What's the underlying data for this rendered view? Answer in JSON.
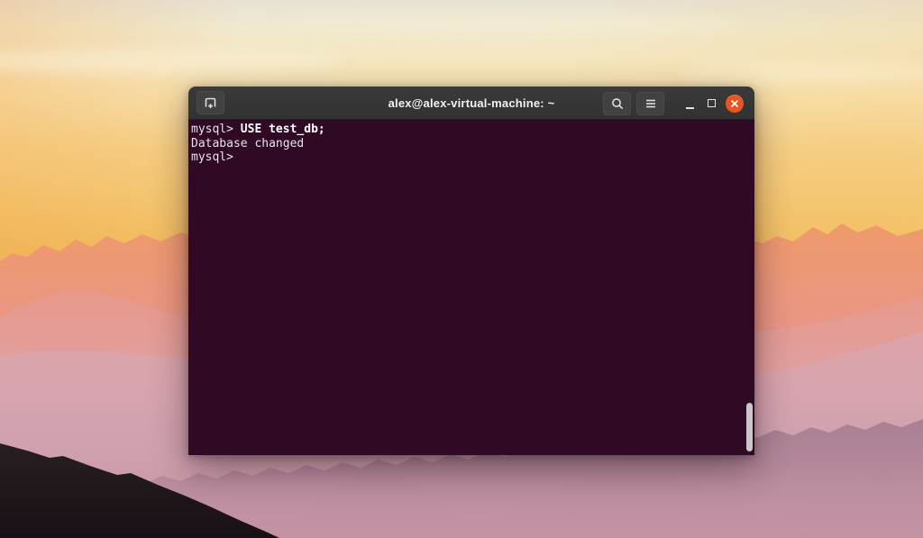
{
  "window": {
    "title": "alex@alex-virtual-machine: ~"
  },
  "terminal": {
    "lines": [
      {
        "prompt": "mysql>",
        "command": "USE test_db;"
      },
      {
        "output": "Database changed"
      },
      {
        "prompt": "mysql>"
      }
    ]
  },
  "icons": {
    "new_tab": "tab-new-icon",
    "search": "magnifier-icon",
    "menu": "hamburger-menu-icon",
    "minimize": "underscore-dash",
    "maximize": "square-outline",
    "close": "x-in-orange-circle"
  },
  "colors": {
    "titlebar_background": "#343434",
    "terminal_background": "#300a24",
    "close_button": "#e95420",
    "terminal_text": "#e9e2e7",
    "command_text": "#ffffff",
    "scrollbar_thumb": "#ccc5c9"
  }
}
